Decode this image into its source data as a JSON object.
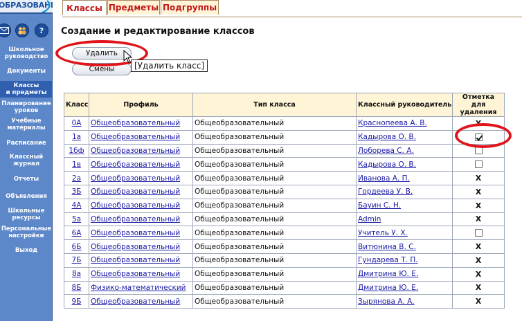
{
  "logo_text": "ОБРАЗОВАНИ",
  "sidebar": {
    "items": [
      {
        "label": "Школьное\nруководство"
      },
      {
        "label": "Документы"
      },
      {
        "label": "Классы\nи предметы"
      },
      {
        "label": "Планирование\nуроков"
      },
      {
        "label": "Учебные\nматериалы"
      },
      {
        "label": "Расписание"
      },
      {
        "label": "Классный\nжурнал"
      },
      {
        "label": "Отчеты"
      },
      {
        "label": "Объявления"
      },
      {
        "label": "Школьные\nресурсы"
      },
      {
        "label": "Персональные\nнастройки"
      },
      {
        "label": "Выход"
      }
    ],
    "active_index": 2
  },
  "tabs": [
    {
      "label": "Классы"
    },
    {
      "label": "Предметы"
    },
    {
      "label": "Подгруппы"
    }
  ],
  "active_tab": 0,
  "page_title": "Создание и редактирование классов",
  "buttons": {
    "delete": "Удалить",
    "shifts": "Смены"
  },
  "tooltip": "[Удалить класс]",
  "table": {
    "headers": [
      "Класс",
      "Профиль",
      "Тип класса",
      "Классный руководитель",
      "Отметка для\nудаления"
    ],
    "rows": [
      {
        "cls": "0А",
        "profile": "Общеобразовательный",
        "type": "Общеобразовательный",
        "teacher": "Краснопеева А. В.",
        "mark": "x"
      },
      {
        "cls": "1а",
        "profile": "Общеобразовательный",
        "type": "Общеобразовательный",
        "teacher": "Кадырова О. В.",
        "mark": "checked"
      },
      {
        "cls": "1бф",
        "profile": "Общеобразовательный",
        "type": "Общеобразовательный",
        "teacher": "Лоборева С. А.",
        "mark": "unchecked"
      },
      {
        "cls": "1в",
        "profile": "Общеобразовательный",
        "type": "Общеобразовательный",
        "teacher": "Кадырова О. В.",
        "mark": "unchecked"
      },
      {
        "cls": "2а",
        "profile": "Общеобразовательный",
        "type": "Общеобразовательный",
        "teacher": "Иванова А. П.",
        "mark": "x"
      },
      {
        "cls": "3Б",
        "profile": "Общеобразовательный",
        "type": "Общеобразовательный",
        "teacher": "Гордеева У. В.",
        "mark": "x"
      },
      {
        "cls": "4А",
        "profile": "Общеобразовательный",
        "type": "Общеобразовательный",
        "teacher": "Бауин С. Н.",
        "mark": "x"
      },
      {
        "cls": "5а",
        "profile": "Общеобразовательный",
        "type": "Общеобразовательный",
        "teacher": "Admin",
        "mark": "x"
      },
      {
        "cls": "6А",
        "profile": "Общеобразовательный",
        "type": "Общеобразовательный",
        "teacher": "Учитель У. Х.",
        "mark": "unchecked"
      },
      {
        "cls": "6Б",
        "profile": "Общеобразовательный",
        "type": "Общеобразовательный",
        "teacher": "Витюнина В. С.",
        "mark": "x"
      },
      {
        "cls": "7Б",
        "profile": "Общеобразовательный",
        "type": "Общеобразовательный",
        "teacher": "Гундарева Т. П.",
        "mark": "x"
      },
      {
        "cls": "8а",
        "profile": "Общеобразовательный",
        "type": "Общеобразовательный",
        "teacher": "Дмитрина Ю. Е.",
        "mark": "x"
      },
      {
        "cls": "8Б",
        "profile": "Физико-математический",
        "type": "Общеобразовательный",
        "teacher": "Дмитрина Ю. Е.",
        "mark": "x"
      },
      {
        "cls": "9Б",
        "profile": "Общеобразовательный",
        "type": "Общеобразовательный",
        "teacher": "Зырянова А. А.",
        "mark": "x"
      }
    ]
  },
  "colors": {
    "sidebar": "#5c87c8",
    "tab_text": "#c01818",
    "highlight_ring": "#e0141a",
    "link": "#1a1aa6",
    "header_bg": "#fff4d6"
  },
  "icons": [
    "mail-icon",
    "people-icon",
    "help-icon",
    "cursor-icon",
    "checkmark-icon"
  ]
}
